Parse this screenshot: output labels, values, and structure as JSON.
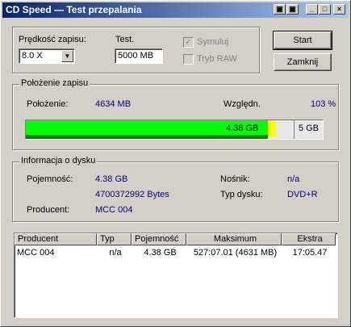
{
  "window": {
    "title": "CD Speed — Test przepalania",
    "buttons": [
      "▣",
      "_",
      "□",
      "×"
    ]
  },
  "write_speed": {
    "label": "Prędkość zapisu:",
    "value": "8.0 X",
    "test_label": "Test.",
    "test_value": "5000 MB"
  },
  "options": {
    "simulate": "Symuluj",
    "raw_mode": "Tryb RAW"
  },
  "actions": {
    "start": "Start",
    "close": "Zamknij"
  },
  "position": {
    "group_title": "Położenie zapisu",
    "position_label": "Położenie:",
    "position_value": "4634 MB",
    "relative_label": "Względn.",
    "relative_value": "103 %",
    "progress_fraction": 0.905,
    "bar_text": "4.38 GB",
    "capacity_label": "5 GB"
  },
  "disc": {
    "group_title": "Informacja o dysku",
    "capacity_label": "Pojemność:",
    "capacity_gb": "4.38 GB",
    "capacity_bytes": "4700372992 Bytes",
    "producer_label": "Producent:",
    "producer_value": "MCC 004",
    "media_label": "Nośnik:",
    "media_value": "n/a",
    "type_label": "Typ dysku:",
    "type_value": "DVD+R"
  },
  "table": {
    "headers": [
      "Producent",
      "Typ",
      "Pojemność",
      "Maksimum",
      "Ekstra"
    ],
    "rows": [
      [
        "MCC 004",
        "n/a",
        "4.38 GB",
        "527:07.01 (4631 MB)",
        "17:05.47"
      ]
    ]
  },
  "colors": {
    "progress": "#00ff00",
    "marker": "#ffff00",
    "value_text": "#000080"
  }
}
